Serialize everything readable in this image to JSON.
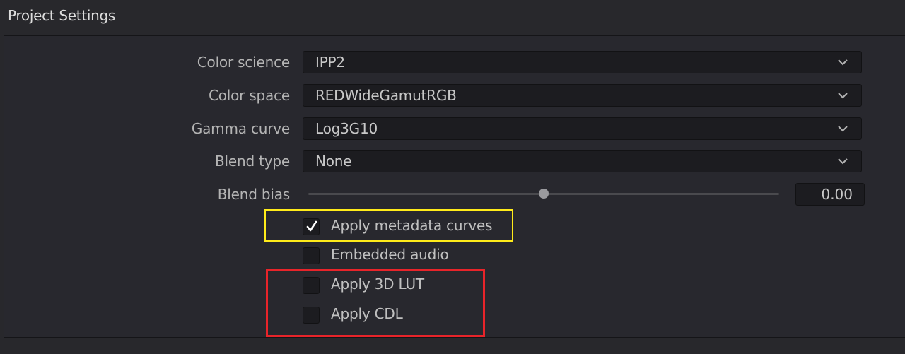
{
  "window": {
    "title": "Project Settings"
  },
  "fields": [
    {
      "label": "Color science",
      "value": "IPP2"
    },
    {
      "label": "Color space",
      "value": "REDWideGamutRGB"
    },
    {
      "label": "Gamma curve",
      "value": "Log3G10"
    },
    {
      "label": "Blend type",
      "value": "None"
    }
  ],
  "blend_bias": {
    "label": "Blend bias",
    "value": "0.00",
    "slider_fraction": 0.5
  },
  "checkboxes": [
    {
      "label": "Apply metadata curves",
      "checked": true
    },
    {
      "label": "Embedded audio",
      "checked": false
    },
    {
      "label": "Apply 3D LUT",
      "checked": false
    },
    {
      "label": "Apply CDL",
      "checked": false
    }
  ],
  "colors": {
    "background": "#28282c",
    "highlight_yellow": "#ffeb1a",
    "highlight_red": "#e8242a"
  },
  "icons": {
    "dropdown": "chevron-down-icon",
    "check": "checkmark-icon"
  }
}
